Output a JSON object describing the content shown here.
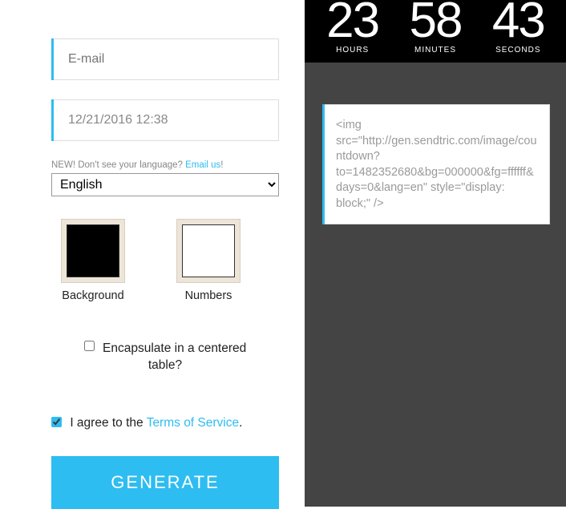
{
  "form": {
    "email_placeholder": "E-mail",
    "datetime_value": "12/21/2016 12:38",
    "lang_note_prefix": "NEW! Don't see your language? ",
    "lang_note_link": "Email us",
    "lang_note_suffix": "!",
    "language_selected": "English",
    "swatches": {
      "background": {
        "label": "Background",
        "color": "#000000"
      },
      "numbers": {
        "label": "Numbers",
        "color": "#ffffff"
      }
    },
    "encapsulate_label": "Encapsulate in a centered table?",
    "terms_prefix": "I agree to the ",
    "terms_link": "Terms of Service",
    "terms_suffix": ".",
    "generate_label": "GENERATE"
  },
  "preview": {
    "countdown": {
      "hours": "23",
      "minutes": "58",
      "seconds": "43",
      "hours_label": "HOURS",
      "minutes_label": "MINUTES",
      "seconds_label": "SECONDS"
    },
    "code": "<img src=\"http://gen.sendtric.com/image/countdown?to=1482352680&bg=000000&fg=ffffff&days=0&lang=en\" style=\"display: block;\" />"
  }
}
